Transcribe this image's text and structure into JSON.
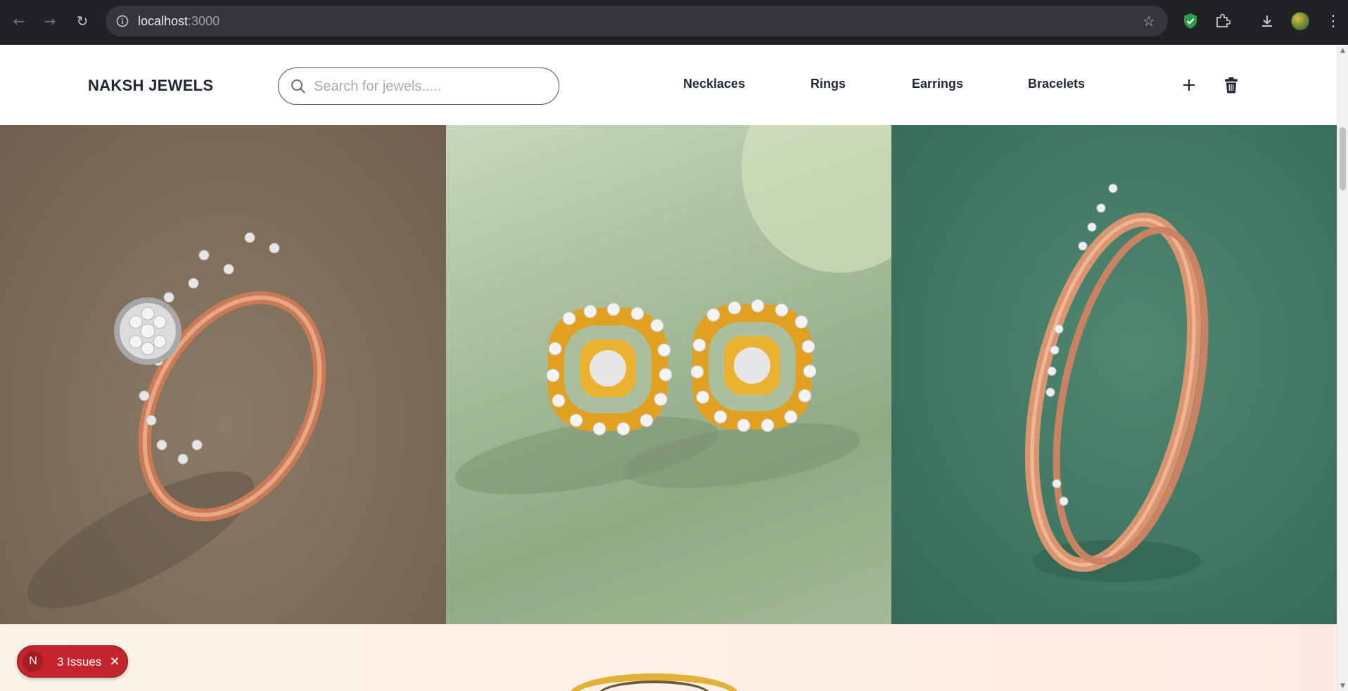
{
  "browser": {
    "url_host": "localhost",
    "url_port": ":3000",
    "icons": {
      "back": "arrow-left-icon",
      "forward": "arrow-right-icon",
      "reload": "reload-icon",
      "site_info": "info-icon",
      "bookmark": "star-icon",
      "extension_shield": "shield-check-icon",
      "extensions": "puzzle-icon",
      "downloads": "download-icon",
      "profile": "avatar",
      "menu": "kebab-menu-icon"
    }
  },
  "header": {
    "brand": "NAKSH JEWELS",
    "search_placeholder": "Search for jewels.....",
    "nav": [
      "Necklaces",
      "Rings",
      "Earrings",
      "Bracelets"
    ],
    "icons": {
      "add": "plus-icon",
      "delete": "trash-icon"
    }
  },
  "hero": {
    "tiles": [
      {
        "name": "ring",
        "background": "#7d6c59",
        "metal": "#d58a64"
      },
      {
        "name": "earrings",
        "background": "#a9bf9d",
        "metal": "#e2a021"
      },
      {
        "name": "bangle",
        "background": "#3e7662",
        "metal": "#d99570"
      }
    ]
  },
  "dev_overlay": {
    "logo_letter": "N",
    "issues_label": "3 Issues",
    "close_icon": "close-icon",
    "color": "#c4242b"
  }
}
